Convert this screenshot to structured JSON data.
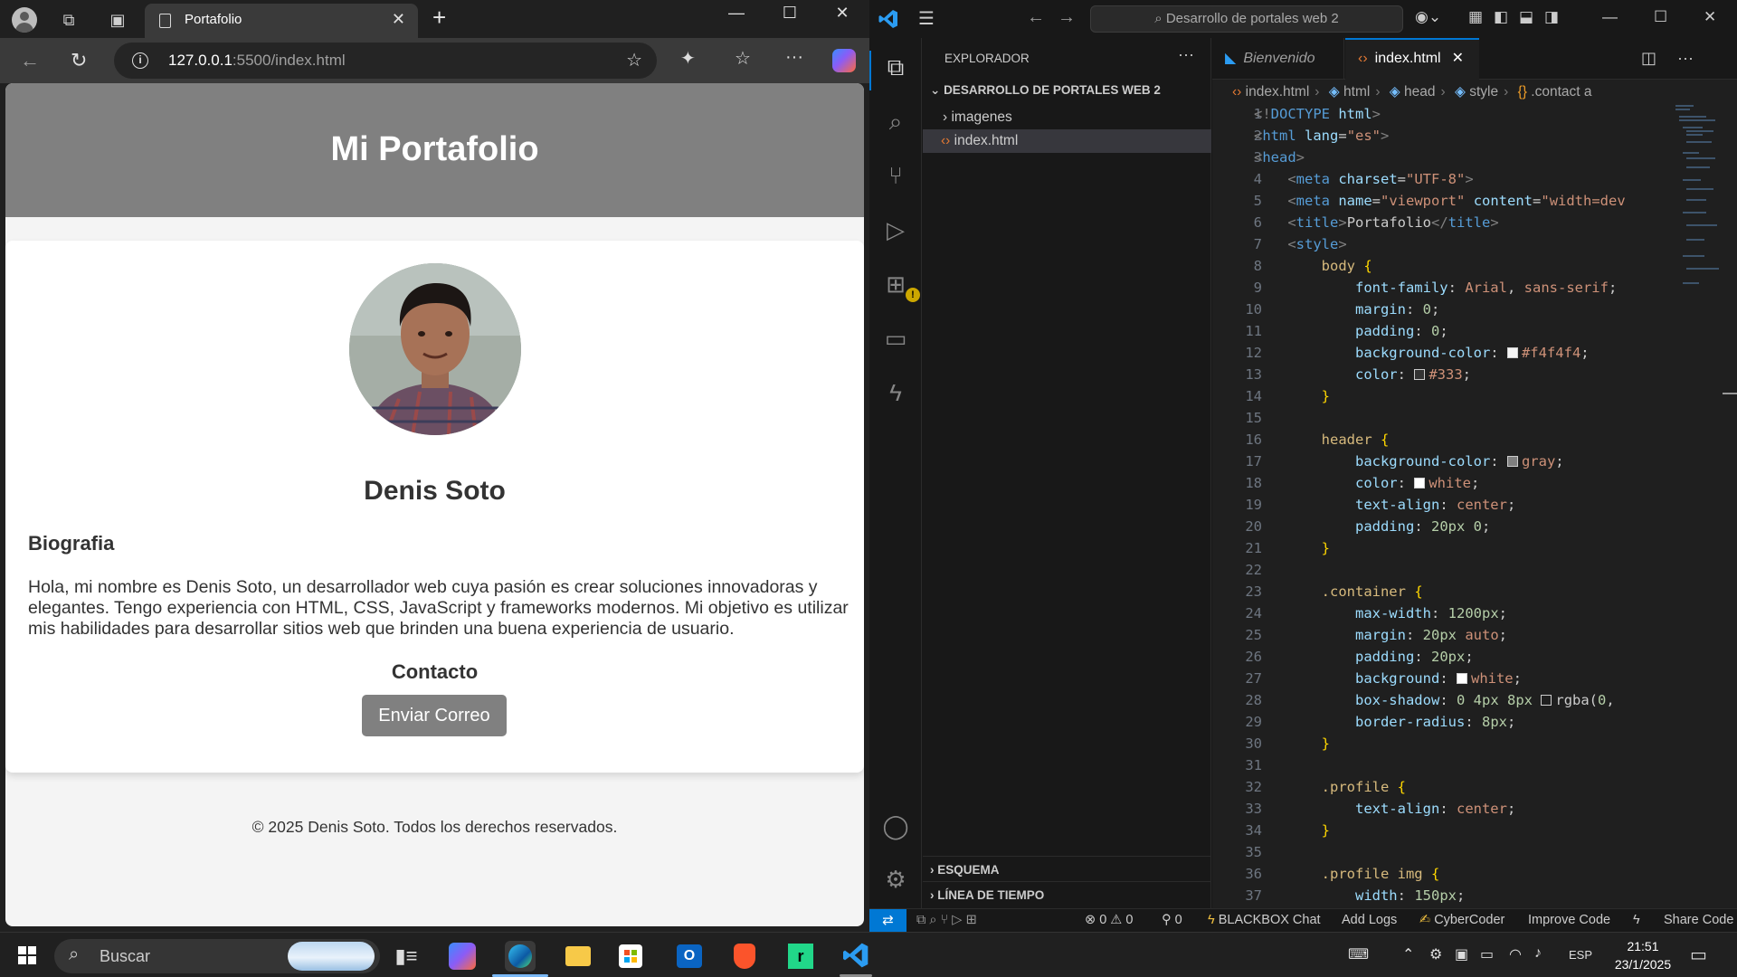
{
  "browser": {
    "tab_title": "Portafolio",
    "url_host": "127.0.0.1",
    "url_rest": ":5500/index.html",
    "close_glyph": "✕",
    "new_tab_glyph": "+"
  },
  "site": {
    "title": "Mi Portafolio",
    "name": "Denis Soto",
    "bio_heading": "Biografia",
    "bio_text": "Hola, mi nombre es Denis Soto, un desarrollador web cuya pasión es crear soluciones innovadoras y elegantes. Tengo experiencia con HTML, CSS, JavaScript y frameworks modernos. Mi objetivo es utilizar mis habilidades para desarrollar sitios web que brinden una buena experiencia de usuario.",
    "contact_heading": "Contacto",
    "mail_button": "Enviar Correo",
    "footer": "© 2025 Denis Soto. Todos los derechos reservados."
  },
  "vscode": {
    "search_text": "Desarrollo de portales web 2",
    "explorer_title": "EXPLORADOR",
    "folder": "DESARROLLO DE PORTALES WEB 2",
    "items": [
      "imagenes",
      "index.html"
    ],
    "section_outline": "ESQUEMA",
    "section_timeline": "LÍNEA DE TIEMPO",
    "tabs": [
      "Bienvenido",
      "index.html"
    ],
    "breadcrumb": [
      "index.html",
      "html",
      "head",
      "style",
      ".contact a"
    ],
    "status": {
      "errors": "0",
      "warnings": "0",
      "ports": "0",
      "blackbox": "BLACKBOX Chat",
      "addlogs": "Add Logs",
      "cybercoder": "CyberCoder",
      "improve": "Improve Code",
      "share": "Share Code"
    }
  },
  "taskbar": {
    "search_label": "Buscar",
    "lang": "ESP",
    "time": "21:51",
    "date": "23/1/2025"
  },
  "colors": {
    "accent": "#0078d4",
    "site_header": "#808080",
    "site_bg": "#f4f4f4"
  }
}
